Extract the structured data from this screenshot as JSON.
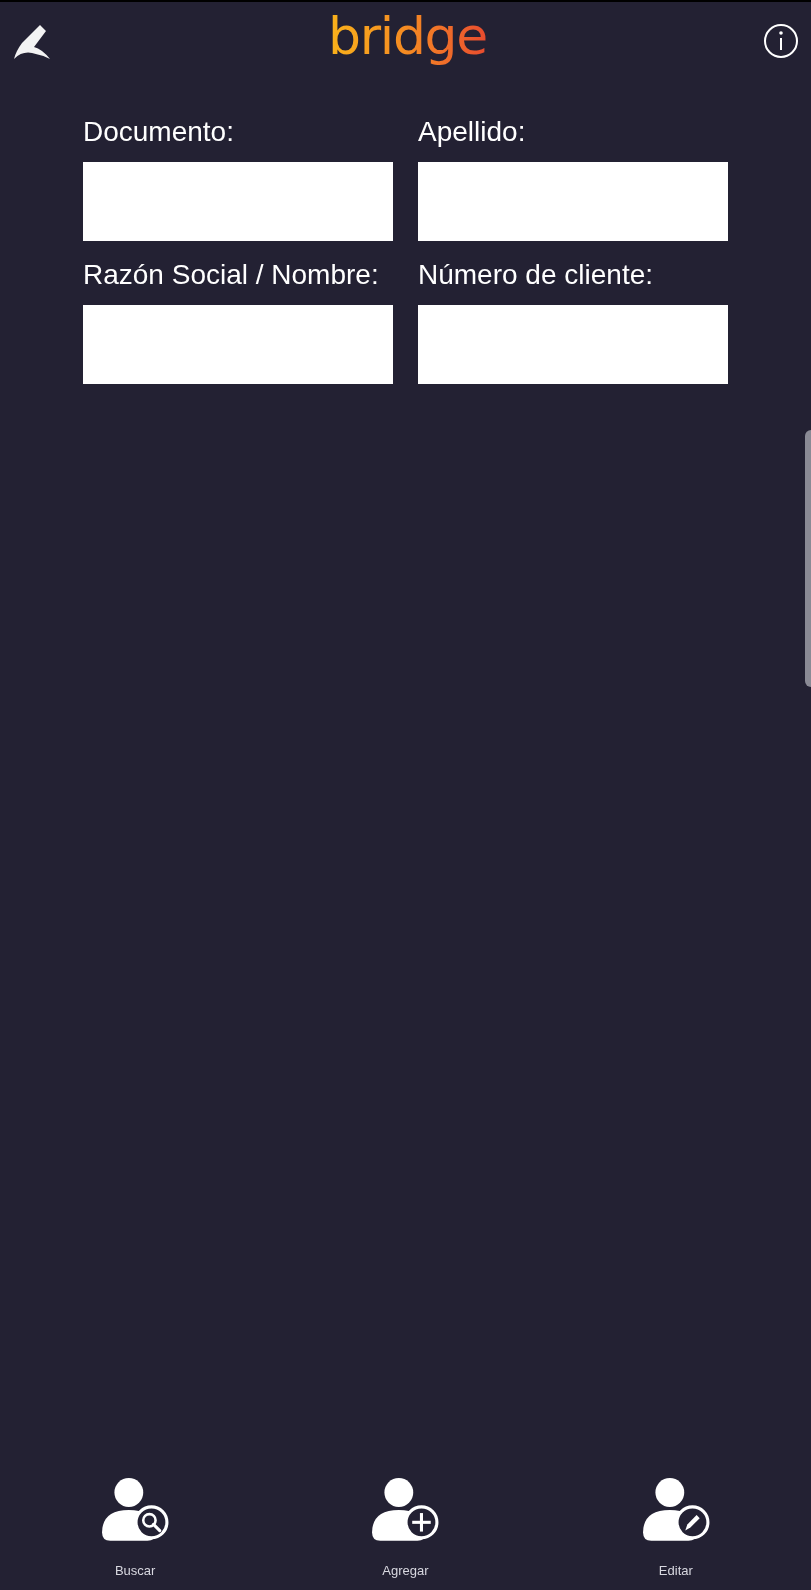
{
  "header": {
    "logo": "bridge"
  },
  "fields": [
    {
      "label": "Documento:"
    },
    {
      "label": "Apellido:"
    },
    {
      "label": "Razón Social / Nombre:"
    },
    {
      "label": "Número de cliente:"
    }
  ],
  "actions": [
    {
      "kind": "search",
      "label": "Buscar"
    },
    {
      "kind": "add",
      "label": "Agregar"
    },
    {
      "kind": "edit",
      "label": "Editar"
    }
  ]
}
